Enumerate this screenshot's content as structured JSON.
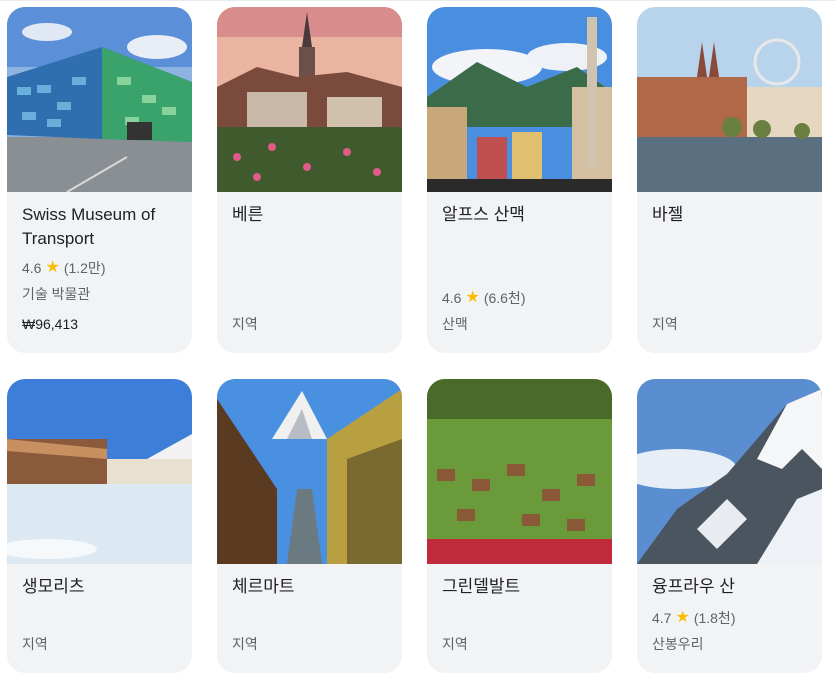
{
  "cards": [
    {
      "title": "Swiss Museum of Transport",
      "rating": "4.6",
      "reviews": "(1.2만)",
      "category": "기술 박물관",
      "price": "₩96,413"
    },
    {
      "title": "베른",
      "category": "지역"
    },
    {
      "title": "알프스 산맥",
      "rating": "4.6",
      "reviews": "(6.6천)",
      "category": "산맥"
    },
    {
      "title": "바젤",
      "category": "지역"
    },
    {
      "title": "생모리츠",
      "category": "지역"
    },
    {
      "title": "체르마트",
      "category": "지역"
    },
    {
      "title": "그린델발트",
      "category": "지역"
    },
    {
      "title": "융프라우 산",
      "rating": "4.7",
      "reviews": "(1.8천)",
      "category": "산봉우리"
    }
  ],
  "icons": {
    "star": "star-icon"
  },
  "colors": {
    "star": "#fbbc04",
    "card_bg": "#f1f3f4",
    "secondary_text": "#5f6368"
  }
}
